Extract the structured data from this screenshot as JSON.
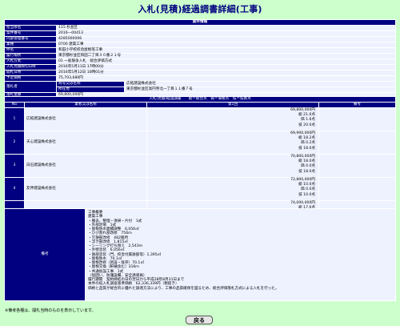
{
  "page": {
    "title": "入札(見積)経過調書詳細(工事)"
  },
  "info": {
    "header": "案件情報",
    "rows": [
      {
        "label": "担当係名",
        "value": "115 杉並区"
      },
      {
        "label": "案件番号",
        "value": "2016―00413"
      },
      {
        "label": "内部管理番号",
        "value": "4285000006"
      },
      {
        "label": "業種",
        "value": "0700 建築工事"
      },
      {
        "label": "件名",
        "value": "和田小学校校舎屋根等工事"
      },
      {
        "label": "履行場所",
        "value": "東京都杉並区和田二丁目３０番２１号"
      },
      {
        "label": "入札方式",
        "value": "01 一般競争入札　総合評価方式"
      },
      {
        "label": "入札見積締切日時",
        "value": "2016年5月11日 17時00分"
      },
      {
        "label": "開札日時",
        "value": "2016年5月12日 10時01分"
      },
      {
        "label": "予定価格",
        "value": "75,703,680円"
      }
    ],
    "winner_label": "落札者",
    "winner_rows": [
      {
        "label": "商号又は名称",
        "value": "広拓建設株式会社"
      },
      {
        "label": "所在地",
        "value": "東京都杉並区高円寺北一丁目１１番７号"
      }
    ],
    "amount": {
      "label": "落札金額",
      "value": "69,800,000円"
    }
  },
  "progress": {
    "header": "入札(見積)経過調書　　総＝総合点　価＝価格点　技＝技術点",
    "col_no": "No",
    "col_name": "業者又は名称",
    "col_round": "第1回",
    "col_note": "備考",
    "rows": [
      {
        "no": "1",
        "name": "広拓建設株式会社",
        "price": "69,800,000円",
        "total": "総 21.6点",
        "price_pt": "価 1.6点",
        "tech": "技 20.0点"
      },
      {
        "no": "2",
        "name": "天心建設株式会社",
        "price": "69,900,000円",
        "total": "総 18.2点",
        "price_pt": "価 0.2点",
        "tech": "技 18.0点"
      },
      {
        "no": "3",
        "name": "白石建設株式会社",
        "price": "70,800,000円",
        "total": "総 18.0点",
        "price_pt": "価 0.0点",
        "tech": "技 18.0点"
      },
      {
        "no": "4",
        "name": "友伸建設株式会社",
        "price": "72,800,000円",
        "total": "総 10.0点",
        "price_pt": "価 0.0点",
        "tech": "技 10.0点"
      },
      {
        "no": "5",
        "name": "国際建設株式会社 東京支社",
        "price": "74,000,000円",
        "total": "総 17.6点",
        "price_pt": "価 0.0点",
        "tech": "技 17.6点"
      }
    ]
  },
  "remarks": {
    "label": "備考",
    "lines": [
      "工事概要",
      "建築工事",
      "・撤去、整理・清掃・片付　1式",
      "・外部足場　1式",
      "・屋根防水面積調整　6,056㎡",
      "・ひび割れ部改修　756ｍ",
      "・欠損部改修　482箇所",
      "・浮き部改修　1,815㎡",
      "・シーリング打ち替え　2,543ｍ",
      "・外壁塗装　6,056㎡",
      "・鉄部塗装（門、校舎付属鉄部等）1,395㎡",
      "・屋根防水　70.1㎡",
      "・屋根改修（新設・既存）70.1㎡",
      "・屋根交換（軒樋含む）316ｍ",
      "・共通仮設工事　1式",
      "（仮囲い、防護設備、安全誘導員）",
      "履行期間　契約締結の日の翌日から平成28年8月31日まで",
      "本件の低入札調査基準価格　62,336,339円（税抜き）",
      "価格と品質が総合的に優れた調達方法により、工事の品質確保を図るため、総合評価落札方式による入札を行った。"
    ]
  },
  "footnote": "※備考各種は、開札当時のものを表示しています。",
  "buttons": {
    "back": "戻る"
  }
}
